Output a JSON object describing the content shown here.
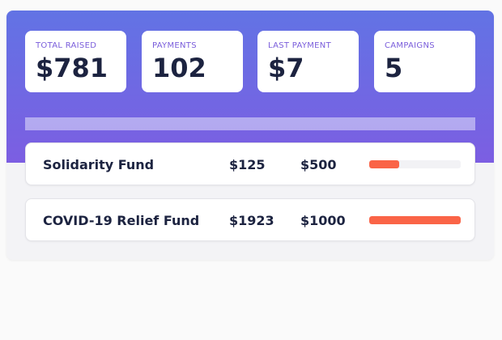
{
  "stats": [
    {
      "label": "TOTAL RAISED",
      "value": "$781"
    },
    {
      "label": "PAYMENTS",
      "value": "102"
    },
    {
      "label": "LAST PAYMENT",
      "value": "$7"
    },
    {
      "label": "CAMPAIGNS",
      "value": "5"
    }
  ],
  "campaigns": [
    {
      "name": "Solidarity Fund",
      "raised": "$125",
      "goal": "$500",
      "progress": 0.33
    },
    {
      "name": "COVID-19 Relief Fund",
      "raised": "$1923",
      "goal": "$1000",
      "progress": 1.0
    }
  ],
  "colors": {
    "hero_top": "#6273e4",
    "hero_bottom": "#7c5ee2",
    "accent_label": "#7a5ddb",
    "progress": "#fa6447",
    "text_dark": "#1c2340"
  }
}
